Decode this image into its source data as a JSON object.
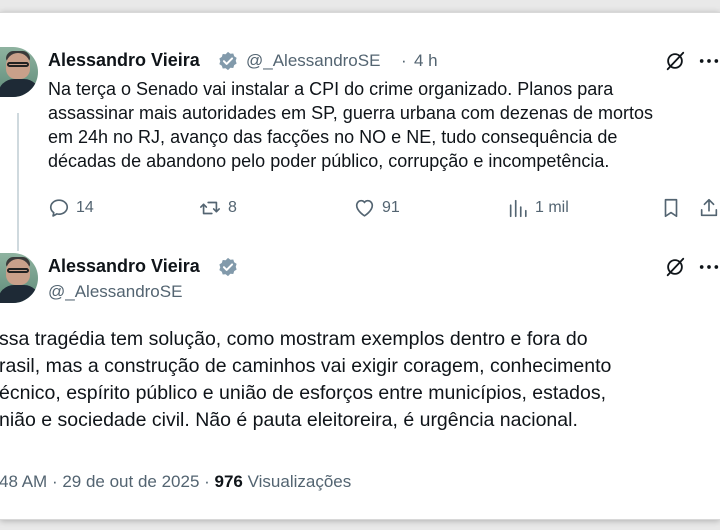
{
  "reply": {
    "author_name": "Alessandro Vieira",
    "handle": "@_AlessandroSE",
    "separator": "·",
    "time_ago": "4 h",
    "lines": [
      "Na terça o Senado vai instalar a CPI do crime organizado. Planos para",
      "assassinar mais autoridades em SP, guerra urbana com dezenas de mortos",
      "em 24h no RJ, avanço das facções no NO e NE, tudo consequência de",
      "décadas de abandono pelo poder público, corrupção e incompetência."
    ],
    "actions": {
      "replies": "14",
      "reposts": "8",
      "likes": "91",
      "views": "1 mil"
    }
  },
  "main_tweet": {
    "author_name": "Alessandro Vieira",
    "handle": "@_AlessandroSE",
    "lines": [
      "ssa tragédia tem solução, como mostram exemplos dentro e fora do",
      "rasil, mas a construção de caminhos vai exigir coragem, conhecimento",
      "écnico, espírito público e união de esforços entre municípios, estados,",
      "nião e sociedade civil. Não é pauta eleitoreira, é urgência nacional."
    ],
    "time": "48 AM",
    "date": "· 29 de out de 2025 ·",
    "views_count": "976",
    "views_label": "Visualizações"
  },
  "colors": {
    "verified": "#1d9bf0",
    "muted": "#536471",
    "text": "#0f1419"
  }
}
